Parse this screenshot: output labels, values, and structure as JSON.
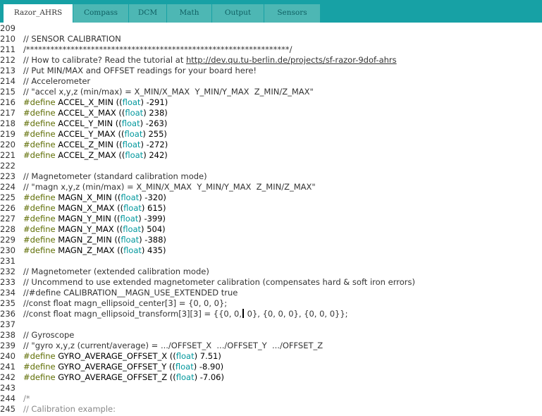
{
  "tabs": [
    {
      "label": "Razor_AHRS",
      "active": true
    },
    {
      "label": "Compass",
      "active": false
    },
    {
      "label": "DCM",
      "active": false
    },
    {
      "label": "Math",
      "active": false
    },
    {
      "label": "Output",
      "active": false
    },
    {
      "label": "Sensors",
      "active": false
    }
  ],
  "lines": [
    {
      "n": "209",
      "t": ""
    },
    {
      "n": "210",
      "t": "// SENSOR CALIBRATION"
    },
    {
      "n": "211",
      "t": "/*****************************************************************/"
    },
    {
      "n": "212",
      "t_pre": "// How to calibrate? Read the tutorial at ",
      "url": "http://dev.qu.tu-berlin.de/projects/sf-razor-9dof-ahrs"
    },
    {
      "n": "213",
      "t": "// Put MIN/MAX and OFFSET readings for your board here!"
    },
    {
      "n": "214",
      "t": "// Accelerometer"
    },
    {
      "n": "215",
      "t": "// \"accel x,y,z (min/max) = X_MIN/X_MAX  Y_MIN/Y_MAX  Z_MIN/Z_MAX\""
    },
    {
      "n": "216",
      "kw": "#define",
      "name": " ACCEL_X_MIN ((",
      "type": "float",
      "val": ") -291)"
    },
    {
      "n": "217",
      "kw": "#define",
      "name": " ACCEL_X_MAX ((",
      "type": "float",
      "val": ") 238)"
    },
    {
      "n": "218",
      "kw": "#define",
      "name": " ACCEL_Y_MIN ((",
      "type": "float",
      "val": ") -263)"
    },
    {
      "n": "219",
      "kw": "#define",
      "name": " ACCEL_Y_MAX ((",
      "type": "float",
      "val": ") 255)"
    },
    {
      "n": "220",
      "kw": "#define",
      "name": " ACCEL_Z_MIN ((",
      "type": "float",
      "val": ") -272)"
    },
    {
      "n": "221",
      "kw": "#define",
      "name": " ACCEL_Z_MAX ((",
      "type": "float",
      "val": ") 242)"
    },
    {
      "n": "222",
      "t": ""
    },
    {
      "n": "223",
      "t": "// Magnetometer (standard calibration mode)"
    },
    {
      "n": "224",
      "t": "// \"magn x,y,z (min/max) = X_MIN/X_MAX  Y_MIN/Y_MAX  Z_MIN/Z_MAX\""
    },
    {
      "n": "225",
      "kw": "#define",
      "name": " MAGN_X_MIN ((",
      "type": "float",
      "val": ") -320)"
    },
    {
      "n": "226",
      "kw": "#define",
      "name": " MAGN_X_MAX ((",
      "type": "float",
      "val": ") 615)"
    },
    {
      "n": "227",
      "kw": "#define",
      "name": " MAGN_Y_MIN ((",
      "type": "float",
      "val": ") -399)"
    },
    {
      "n": "228",
      "kw": "#define",
      "name": " MAGN_Y_MAX ((",
      "type": "float",
      "val": ") 504)"
    },
    {
      "n": "229",
      "kw": "#define",
      "name": " MAGN_Z_MIN ((",
      "type": "float",
      "val": ") -388)"
    },
    {
      "n": "230",
      "kw": "#define",
      "name": " MAGN_Z_MAX ((",
      "type": "float",
      "val": ") 435)"
    },
    {
      "n": "231",
      "t": ""
    },
    {
      "n": "232",
      "t": "// Magnetometer (extended calibration mode)"
    },
    {
      "n": "233",
      "t": "// Uncommend to use extended magnetometer calibration (compensates hard & soft iron errors)"
    },
    {
      "n": "234",
      "t": "//#define CALIBRATION__MAGN_USE_EXTENDED true"
    },
    {
      "n": "235",
      "t": "//const float magn_ellipsoid_center[3] = {0, 0, 0};"
    },
    {
      "n": "236",
      "t_pre": "//const float magn_ellipsoid_transform[3][3] = {{0, 0,",
      "t_post": " 0}, {0, 0, 0}, {0, 0, 0}};"
    },
    {
      "n": "237",
      "t": ""
    },
    {
      "n": "238",
      "t": "// Gyroscope"
    },
    {
      "n": "239",
      "t": "// \"gyro x,y,z (current/average) = .../OFFSET_X  .../OFFSET_Y  .../OFFSET_Z"
    },
    {
      "n": "240",
      "kw": "#define",
      "name": " GYRO_AVERAGE_OFFSET_X ((",
      "type": "float",
      "val": ") 7.51)"
    },
    {
      "n": "241",
      "kw": "#define",
      "name": " GYRO_AVERAGE_OFFSET_Y ((",
      "type": "float",
      "val": ") -8.90)"
    },
    {
      "n": "242",
      "kw": "#define",
      "name": " GYRO_AVERAGE_OFFSET_Z ((",
      "type": "float",
      "val": ") -7.06)"
    },
    {
      "n": "243",
      "t": ""
    },
    {
      "n": "244",
      "t": "/*",
      "light": true
    },
    {
      "n": "245",
      "t": "// Calibration example:",
      "light": true
    }
  ]
}
